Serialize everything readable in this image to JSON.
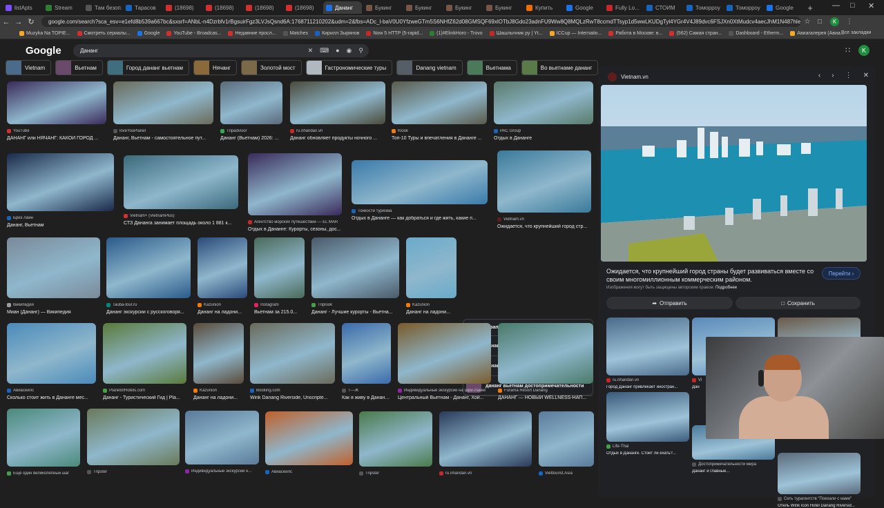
{
  "browser": {
    "tabs": [
      {
        "label": "listApts",
        "color": "#7c4dff"
      },
      {
        "label": "Stream",
        "color": "#2e7d32"
      },
      {
        "label": "Там безоп...",
        "color": "#555555"
      },
      {
        "label": "Тарасов",
        "color": "#1565c0"
      },
      {
        "label": "(18698)",
        "color": "#d32f2f"
      },
      {
        "label": "(18698)",
        "color": "#d32f2f"
      },
      {
        "label": "(18698)",
        "color": "#d32f2f"
      },
      {
        "label": "(18698)",
        "color": "#d32f2f"
      },
      {
        "label": "Дананг",
        "color": "#1a73e8",
        "active": true
      },
      {
        "label": "Букинг",
        "color": "#795548"
      },
      {
        "label": "Букинг",
        "color": "#795548"
      },
      {
        "label": "Букинг",
        "color": "#795548"
      },
      {
        "label": "Букинг",
        "color": "#795548"
      },
      {
        "label": "Купить",
        "color": "#ef6c00"
      },
      {
        "label": "Google",
        "color": "#1a73e8"
      },
      {
        "label": "Fully Lo...",
        "color": "#c62828"
      },
      {
        "label": "СТОИМ",
        "color": "#1565c0"
      },
      {
        "label": "Томорроу",
        "color": "#1565c0"
      },
      {
        "label": "Томорроу",
        "color": "#1565c0"
      },
      {
        "label": "Google",
        "color": "#1a73e8"
      }
    ],
    "url": "google.com/search?sca_esv=e1efd8b539a667bc&sxsrf=ANbL-n4Dzrbfv1rBgsuirFgz3LVJsQsnd6A:1768711210202&udm=2&fbs=ADc_l-baV0U0YfzweGTm5S6NHfZ62d08GMSQF69xlOTbJ8Gdo23adnFU9Ww8Q8MQLzRwT8ccmdTTsyp1d5wwLKUDgTyl4YGr4V4J89dvc6FSJXn0XtMudcv4aecJhM1N487hle1MIiQ8QDfPDmDmAK1P7ftAOAmiiyVNn3tNewM...",
    "bookmarks": [
      {
        "label": "Muzyka Na TOPIE...",
        "color": "#f9a825"
      },
      {
        "label": "Смотреть сериалы...",
        "color": "#d32f2f"
      },
      {
        "label": "Google",
        "color": "#1a73e8"
      },
      {
        "label": "YouTube - Broadcas...",
        "color": "#d32f2f"
      },
      {
        "label": "Недавние просл...",
        "color": "#d32f2f"
      },
      {
        "label": "Matches",
        "color": "#555555"
      },
      {
        "label": "Кирилл Зырянов",
        "color": "#1565c0"
      },
      {
        "label": "Now 5 HTTP (5-rapid...",
        "color": "#c62828"
      },
      {
        "label": "(1)#ElinkHoro - Trovo",
        "color": "#2e7d32"
      },
      {
        "label": "Шашлычник ру | Yt...",
        "color": "#c62828"
      },
      {
        "label": "ICCup — Internatio...",
        "color": "#f9a825"
      },
      {
        "label": "Работа в Москве: в...",
        "color": "#d32f2f"
      },
      {
        "label": "(562) Самая стран...",
        "color": "#d32f2f"
      },
      {
        "label": "Dashboard - Etherm...",
        "color": "#555555"
      },
      {
        "label": "Авиагалерея (Авиа...",
        "color": "#f9a825"
      }
    ],
    "all_bookmarks": "Все закладки",
    "avatar_letter": "K"
  },
  "google": {
    "logo": "Google",
    "query": "Дананг",
    "avatar_letter": "K",
    "chips": [
      {
        "label": "Vietnam",
        "color": "#4a6b8a"
      },
      {
        "label": "Вьетнам",
        "color": "#6a4a6a"
      },
      {
        "label": "Город дананг вьетнам",
        "color": "#3f6f7f"
      },
      {
        "label": "Нячанг",
        "color": "#8a6a3a"
      },
      {
        "label": "Золотой мост",
        "color": "#7a6a4a"
      },
      {
        "label": "Гастрономические туры",
        "color": "#b0b8c0"
      },
      {
        "label": "Danang vietnam",
        "color": "#555e66"
      },
      {
        "label": "Вьетнама",
        "color": "#4a7a5a"
      },
      {
        "label": "Во вьетнаме дананг",
        "color": "#5a7a4a"
      },
      {
        "label": "Дананг",
        "color": "#9a6a2a"
      }
    ],
    "results": [
      {
        "source": "YouTube",
        "caption": "ДАНАНГ или НЯЧАНГ: КАКОЙ ГОРОД ...",
        "color": "#3a2a5a",
        "icon": "#d32f2f"
      },
      {
        "source": "loveYouPlanet",
        "caption": "Дананг, Вьетнам - самостоятельное пут...",
        "color": "#6a6a5a",
        "icon": "#555555"
      },
      {
        "source": "Tripadvisor",
        "caption": "Дананг (Вьетнам) 2026: ...",
        "color": "#5a6a7a",
        "icon": "#34a853"
      },
      {
        "source": "ru.nhandan.vn",
        "caption": "Дананг обновляет продукты ночного ...",
        "color": "#4a4a3a",
        "icon": "#c62828"
      },
      {
        "source": "Klook",
        "caption": "Топ-10 Туры и впечатления в Дананге ...",
        "color": "#5a5a4a",
        "icon": "#f57c00"
      },
      {
        "source": "PAC Group",
        "caption": "Отдых в Дананге",
        "color": "#5a7a6a",
        "icon": "#1565c0"
      },
      {
        "source": "Бриз Лайн",
        "caption": "Дананг, Вьетнам",
        "color": "#1a2a4a",
        "icon": "#1565c0"
      },
      {
        "source": "Vietnam+ (VietnamPlus)",
        "caption": "СТЗ Дананга занимает площадь около 1 881 к...",
        "color": "#3a6a7a",
        "icon": "#d32f2f"
      },
      {
        "source": "Агентство морских путешествий — EL MAR",
        "caption": "Отдых в Дананге: Курорты, сезоны, дос...",
        "color": "#3a2a5a",
        "icon": "#c62828"
      },
      {
        "source": "Тонкости туризма",
        "caption": "Отдых в Дананге — как добраться и где жить, какие п...",
        "color": "#3a7aaa",
        "icon": "#1565c0"
      },
      {
        "source": "Vietnam.vn",
        "caption": "Ожидается, что крупнейший город стр...",
        "color": "#3a7a9a",
        "icon": "#5f1d1d"
      },
      {
        "source": "Википедия",
        "caption": "Миан (Дананг) — Википедия",
        "color": "#7a8a9a",
        "icon": "#9e9e9e"
      },
      {
        "source": "Tauba-tour.ru",
        "caption": "Дананг экскурсии с русскоговоря...",
        "color": "#2a5a8a",
        "icon": "#00897b"
      },
      {
        "source": "Kazunion",
        "caption": "Дананг на ладони...",
        "color": "#2a4a7a",
        "icon": "#f57c00"
      },
      {
        "source": "Instagram",
        "caption": "Вьетнам за 215.0...",
        "color": "#4a6a5a",
        "icon": "#e91e63"
      },
      {
        "source": "Triplook",
        "caption": "Дананг - Лучшие курорты - Вьетна...",
        "color": "#4a5a6a",
        "icon": "#43a047"
      },
      {
        "source": "Kazunion",
        "caption": "Дананг на ладони...",
        "color": "#6aaaca",
        "icon": "#f57c00"
      },
      {
        "source": "Авиасейлс",
        "caption": "Сколько стоит жить в Дананге мес...",
        "color": "#4a8aba",
        "icon": "#1565c0"
      },
      {
        "source": "PlanetofHotels.com",
        "caption": "Дананг - Туристический Гид | Pla...",
        "color": "#5a7a3a",
        "icon": "#43a047"
      },
      {
        "source": "Kazunion",
        "caption": "Дананг на ладони...",
        "color": "#5a4a3a",
        "icon": "#f57c00"
      },
      {
        "source": "Booking.com",
        "caption": "Wink Danang Riverside, Unscripte...",
        "color": "#6a6a5a",
        "icon": "#1565c0"
      },
      {
        "source": "T—Ж",
        "caption": "Как я живу в Дананге ...",
        "color": "#3a6aaa",
        "icon": "#555555"
      },
      {
        "source": "Индивидуальные экскурсии на Шри-Ланке",
        "caption": "Центральный Вьетнам - Дананг, Хой...",
        "color": "#7a5a2a",
        "icon": "#8e24aa"
      },
      {
        "source": "Furama Resort Danang",
        "caption": "ДАНАНГ — НОВЫЙ WELLNESS-НАП...",
        "color": "#4a7a6a",
        "icon": "#f57c00"
      },
      {
        "source": "Ещё один великолепный шаг",
        "caption": "",
        "color": "#4a8a7a",
        "icon": "#43a047"
      },
      {
        "source": "Tripster",
        "caption": "",
        "color": "#6a7a5a",
        "icon": "#555555"
      },
      {
        "source": "Индивидуальные экскурсии н...",
        "caption": "",
        "color": "#5a7a9a",
        "icon": "#8e24aa"
      },
      {
        "source": "Авиасейлс",
        "caption": "",
        "color": "#c0602a",
        "icon": "#1565c0"
      },
      {
        "source": "Tripster",
        "caption": "",
        "color": "#4a7a4a",
        "icon": "#555555"
      },
      {
        "source": "ru.nhandan.vn",
        "caption": "",
        "color": "#2a3a5a",
        "icon": "#c62828"
      },
      {
        "source": "Viettourist.Asia",
        "caption": "",
        "color": "#5a7a9a",
        "icon": "#1565c0"
      }
    ],
    "related": {
      "title": "Похожие запросы",
      "items": [
        {
          "label": "дананг пляжи",
          "color": "#4a7a9a"
        },
        {
          "label": "дананг улицы",
          "color": "#6a7a8a"
        },
        {
          "label": "дананг вьетнам достопримечательности",
          "color": "#6a4a6a"
        }
      ]
    }
  },
  "panel": {
    "source": "Vietnam.vn",
    "title": "Ожидается, что крупнейший город страны будет развиваться вместе со своим многомиллионным коммерческим районом.",
    "visit": "Перейти",
    "copyright": "Изображения могут быть защищены авторским правом.",
    "more": "Подробнее",
    "send": "Отправить",
    "save": "Сохранить",
    "related": [
      {
        "source": "ru.nhandan.vn",
        "caption": "Город Дананг привлекает иностран...",
        "color": "#4a6a8a",
        "icon": "#c62828"
      },
      {
        "source": "Vi",
        "caption": "Дан",
        "color": "#5a8aba",
        "icon": "#c62828"
      },
      {
        "source": "",
        "caption": "",
        "color": "#6a5a4a",
        "icon": "#555555"
      },
      {
        "source": "Life-Thai",
        "caption": "Отдых в Дананге. Стоит ли ехать?...",
        "color": "#3a5a7a",
        "icon": "#43a047"
      },
      {
        "source": "Достопримечательности мира",
        "caption": "Дананг и главные...",
        "color": "#4a7a9a",
        "icon": "#555555"
      },
      {
        "source": "Сеть турагентств \"Поехали с нами\"",
        "caption": "Отель Wink Icon Hotel Danang Riversid...",
        "color": "#5a6a7a",
        "icon": "#555555"
      }
    ]
  }
}
